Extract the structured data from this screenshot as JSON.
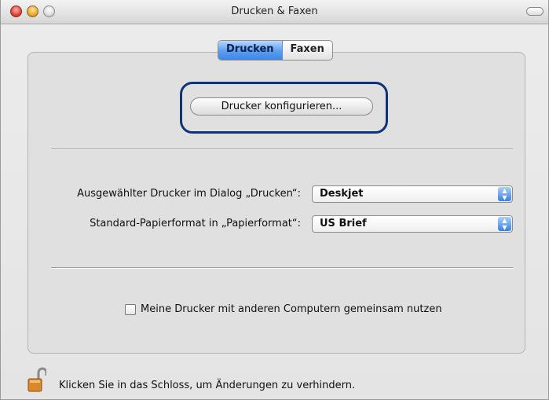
{
  "window": {
    "title": "Drucken & Faxen"
  },
  "tabs": [
    {
      "label": "Drucken",
      "active": true
    },
    {
      "label": "Faxen",
      "active": false
    }
  ],
  "config_button": {
    "label": "Drucker konfigurieren..."
  },
  "settings": {
    "printer_label": "Ausgewählter Drucker im Dialog „Drucken“:",
    "printer_value": "Deskjet",
    "paper_label": "Standard-Papierformat in „Papierformat“:",
    "paper_value": "US Brief"
  },
  "sharing": {
    "label": "Meine Drucker mit anderen Computern gemeinsam nutzen",
    "checked": false
  },
  "lock": {
    "text": "Klicken Sie in das Schloss, um Änderungen zu verhindern.",
    "icon": "open-lock-icon"
  },
  "colors": {
    "accent": "#3f86e6",
    "focus_ring": "#10327a"
  }
}
